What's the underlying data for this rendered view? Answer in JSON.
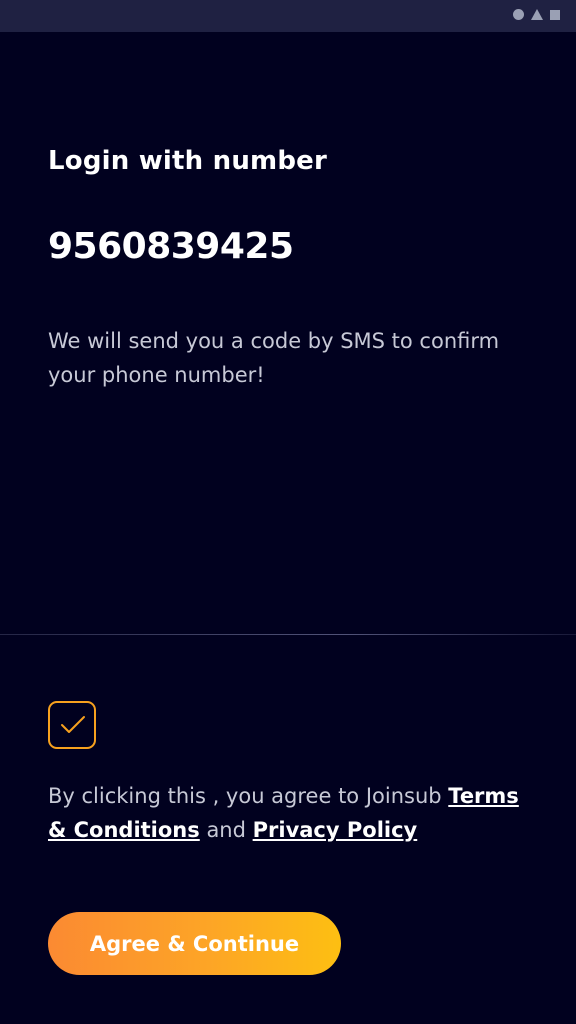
{
  "status_bar": {
    "icons": [
      "circle-icon",
      "triangle-icon",
      "square-icon"
    ]
  },
  "login": {
    "title": "Login with number",
    "phone_number": "9560839425",
    "info_text": "We will send you a code by SMS to confirm your phone number!"
  },
  "consent": {
    "checked": true,
    "text_prefix": "By clicking this , you agree to Joinsub ",
    "terms_link": "Terms & Conditions",
    "connector": " and ",
    "privacy_link": "Privacy Policy"
  },
  "cta": {
    "label": "Agree & Continue"
  },
  "colors": {
    "background": "#01011f",
    "accent_start": "#fb8a32",
    "accent_end": "#fdbf12",
    "checkbox_border": "#f7a11e"
  }
}
